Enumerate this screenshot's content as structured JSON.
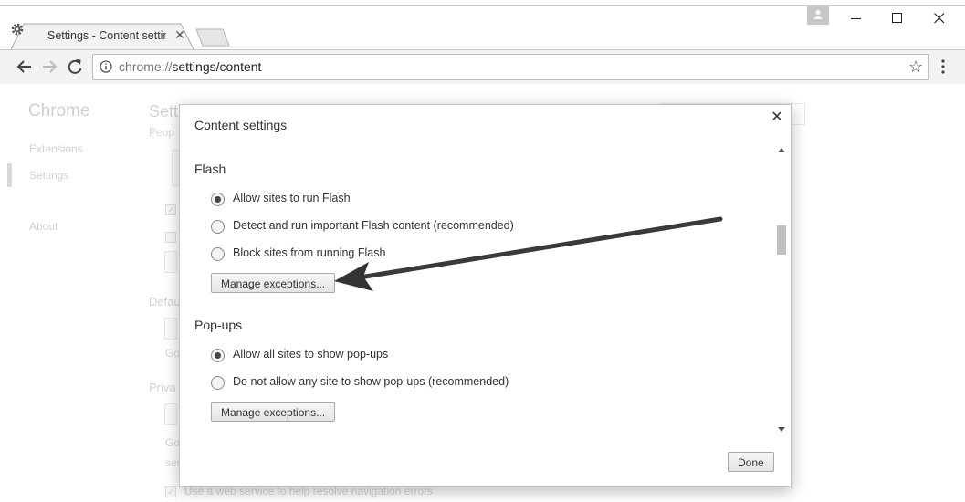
{
  "browser": {
    "tab_title": "Settings - Content settings",
    "url_host": "chrome://",
    "url_path": "settings/content",
    "icons": [
      "settings-gear-icon",
      "close-icon",
      "profile-icon",
      "minimize-icon",
      "maximize-icon",
      "window-close-icon",
      "back-icon",
      "forward-icon",
      "reload-icon",
      "info-icon",
      "star-icon",
      "menu-icon"
    ]
  },
  "settings_page": {
    "brand": "Chrome",
    "nav": [
      "Extensions",
      "Settings",
      "About"
    ],
    "page_title": "Settings",
    "fragments": {
      "people": "Peop",
      "default": "Defau",
      "go1": "Go",
      "privacy": "Priva",
      "go2": "Go",
      "ser": "ser",
      "nav_errors": "Use a web service to help resolve navigation errors"
    }
  },
  "dialog": {
    "title": "Content settings",
    "close_icon": "close-icon",
    "flash": {
      "heading": "Flash",
      "options": [
        {
          "label": "Allow sites to run Flash",
          "checked": true
        },
        {
          "label": "Detect and run important Flash content (recommended)",
          "checked": false
        },
        {
          "label": "Block sites from running Flash",
          "checked": false
        }
      ],
      "manage_button": "Manage exceptions..."
    },
    "popups": {
      "heading": "Pop-ups",
      "options": [
        {
          "label": "Allow all sites to show pop-ups",
          "checked": true
        },
        {
          "label": "Do not allow any site to show pop-ups (recommended)",
          "checked": false
        }
      ],
      "manage_button": "Manage exceptions..."
    },
    "done_button": "Done"
  },
  "annotation": {
    "arrow_color": "#333333"
  }
}
